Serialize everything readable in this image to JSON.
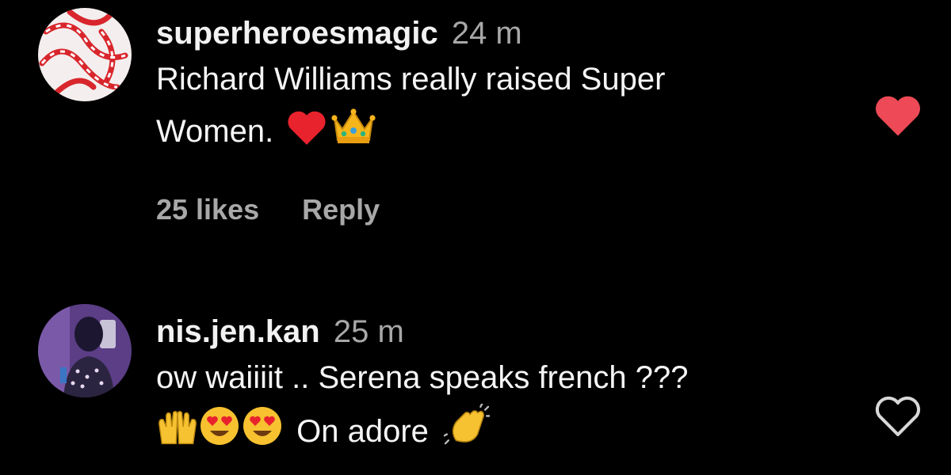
{
  "comments": [
    {
      "username": "superheroesmagic",
      "time": "24 m",
      "text_line1": "Richard Williams really raised Super",
      "text_line2": "Women.",
      "likes": "25 likes",
      "reply_label": "Reply",
      "liked": true,
      "avatar_icon": "candy-cane-avatar",
      "emojis": [
        "red-heart-emoji",
        "crown-emoji"
      ]
    },
    {
      "username": "nis.jen.kan",
      "time": "25 m",
      "text_line1": "ow waiiiit .. Serena speaks french ???",
      "text_line2": "On adore",
      "liked": false,
      "avatar_icon": "person-photo-avatar",
      "emojis": [
        "raising-hands-emoji",
        "heart-eyes-emoji",
        "heart-eyes-emoji",
        "clapping-hands-emoji"
      ]
    }
  ],
  "colors": {
    "background": "#000000",
    "like_red": "#ed4956",
    "muted": "#a8a8a8",
    "text": "#f5f5f5"
  }
}
